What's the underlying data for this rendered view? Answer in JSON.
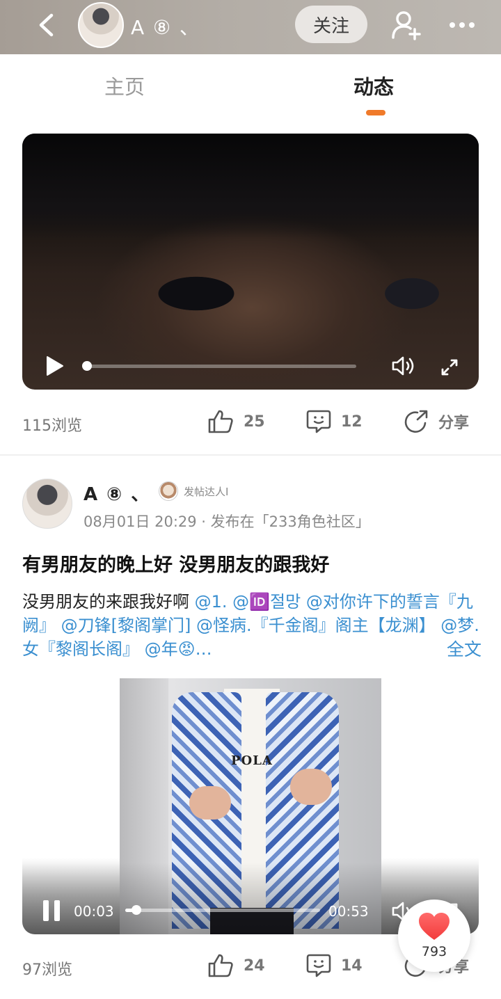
{
  "header": {
    "user_name": "A ⑧ 、",
    "follow_label": "关注"
  },
  "tabs": [
    {
      "label": "主页",
      "active": false
    },
    {
      "label": "动态",
      "active": true
    }
  ],
  "accent_color": "#f07a2a",
  "mention_color": "#3a8fd0",
  "feed": [
    {
      "type": "video",
      "views": "115浏览",
      "likes": "25",
      "comments": "12",
      "share_label": "分享",
      "playback": {
        "progress": 0
      }
    },
    {
      "type": "post",
      "author": "A ⑧ 、",
      "badge": "发帖达人I",
      "meta": "08月01日 20:29 · 发布在「233角色社区」",
      "title": "有男朋友的晚上好 没男朋友的跟我好",
      "body_text": "没男朋友的来跟我好啊 ",
      "mentions": [
        "@1. ",
        "@🆔절망 ",
        "@对你许下的誓言『九阙』 ",
        "@刀锋[黎阁掌门] ",
        "@怪病.『千金阁』阁主【龙渊】 ",
        "@梦.女『黎阁长阁』 ",
        "@年😡…"
      ],
      "full_text_label": "全文",
      "video": {
        "shirt_text": "POLA",
        "current_time": "00:03",
        "total_time": "00:53",
        "progress": 0.057
      },
      "views": "97浏览",
      "likes": "24",
      "comments": "14",
      "share_label": "分享"
    }
  ],
  "floating_like": {
    "count": "793"
  }
}
